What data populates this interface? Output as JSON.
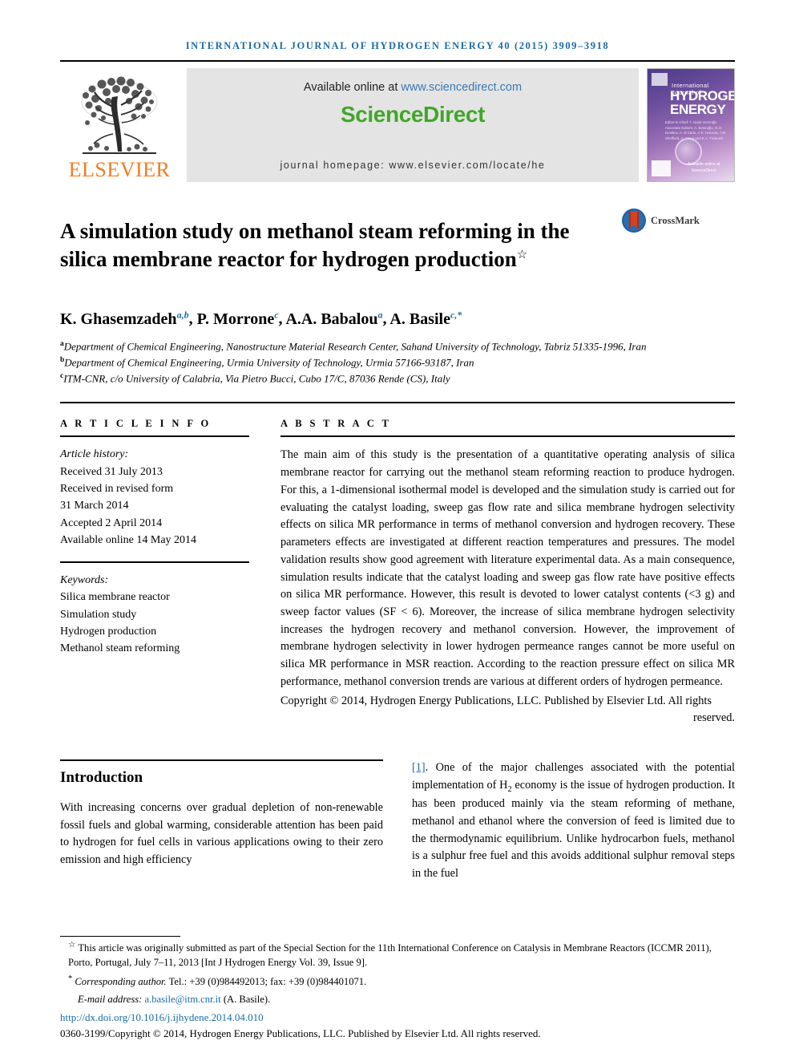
{
  "running_head": "International Journal of Hydrogen Energy 40 (2015) 3909–3918",
  "masthead": {
    "publisher": "ELSEVIER",
    "available_prefix": "Available online at ",
    "available_url": "www.sciencedirect.com",
    "sciencedirect_logo": "ScienceDirect",
    "journal_homepage": "journal homepage: www.elsevier.com/locate/he",
    "cover": {
      "line1": "International Journal of",
      "line2": "HYDROGEN",
      "line3": "ENERGY",
      "editors": "Editor-in-Chief: T. Nejat Veziroğlu    Associate Editors: A. Bekiroğlu, D.O. Dunikov, A. di Carlo, A.E. Hosoda, J.W. Sheffield, G. Gürel and E.A. Ticianelli",
      "footer": "Available online at ScienceDirect"
    }
  },
  "article": {
    "title": "A simulation study on methanol steam reforming in the silica membrane reactor for hydrogen production",
    "title_footnote_marker": "☆",
    "crossmark_label": "CrossMark",
    "authors": [
      {
        "name": "K. Ghasemzadeh",
        "marks": "a,b"
      },
      {
        "name": "P. Morrone",
        "marks": "c"
      },
      {
        "name": "A.A. Babalou",
        "marks": "a"
      },
      {
        "name": "A. Basile",
        "marks": "c,*"
      }
    ],
    "affiliations": [
      {
        "mark": "a",
        "text": "Department of Chemical Engineering, Nanostructure Material Research Center, Sahand University of Technology, Tabriz 51335-1996, Iran"
      },
      {
        "mark": "b",
        "text": "Department of Chemical Engineering, Urmia University of Technology, Urmia 57166-93187, Iran"
      },
      {
        "mark": "c",
        "text": "ITM-CNR, c/o University of Calabria, Via Pietro Bucci, Cubo 17/C, 87036 Rende (CS), Italy"
      }
    ]
  },
  "article_info": {
    "heading": "A R T I C L E   I N F O",
    "history_label": "Article history:",
    "history": [
      "Received 31 July 2013",
      "Received in revised form",
      "31 March 2014",
      "Accepted 2 April 2014",
      "Available online 14 May 2014"
    ],
    "keywords_label": "Keywords:",
    "keywords": [
      "Silica membrane reactor",
      "Simulation study",
      "Hydrogen production",
      "Methanol steam reforming"
    ]
  },
  "abstract": {
    "heading": "A B S T R A C T",
    "text": "The main aim of this study is the presentation of a quantitative operating analysis of silica membrane reactor for carrying out the methanol steam reforming reaction to produce hydrogen. For this, a 1-dimensional isothermal model is developed and the simulation study is carried out for evaluating the catalyst loading, sweep gas flow rate and silica membrane hydrogen selectivity effects on silica MR performance in terms of methanol conversion and hydrogen recovery. These parameters effects are investigated at different reaction temperatures and pressures. The model validation results show good agreement with literature experimental data. As a main consequence, simulation results indicate that the catalyst loading and sweep gas flow rate have positive effects on silica MR performance. However, this result is devoted to lower catalyst contents (<3 g) and sweep factor values (SF < 6). Moreover, the increase of silica membrane hydrogen selectivity increases the hydrogen recovery and methanol conversion. However, the improvement of membrane hydrogen selectivity in lower hydrogen permeance ranges cannot be more useful on silica MR performance in MSR reaction. According to the reaction pressure effect on silica MR performance, methanol conversion trends are various at different orders of hydrogen permeance.",
    "copyright": "Copyright © 2014, Hydrogen Energy Publications, LLC. Published by Elsevier Ltd. All rights",
    "copyright_tail": "reserved."
  },
  "body": {
    "section_title": "Introduction",
    "left_paragraph": "With increasing concerns over gradual depletion of non-renewable fossil fuels and global warming, considerable attention has been paid to hydrogen for fuel cells in various applications owing to their zero emission and high efficiency",
    "right_reference": "[1]",
    "right_paragraph": ". One of the major challenges associated with the potential implementation of H2 economy is the issue of hydrogen production. It has been produced mainly via the steam reforming of methane, methanol and ethanol where the conversion of feed is limited due to the thermodynamic equilibrium. Unlike hydrocarbon fuels, methanol is a sulphur free fuel and this avoids additional sulphur removal steps in the fuel"
  },
  "footnotes": {
    "star_marker": "☆",
    "star_text": "This article was originally submitted as part of the Special Section for the 11th International Conference on Catalysis in Membrane Reactors (ICCMR 2011), Porto, Portugal, July 7–11, 2013 [Int J Hydrogen Energy Vol. 39, Issue 9].",
    "corresponding_marker": "*",
    "corresponding_label": "Corresponding author.",
    "corresponding_text": " Tel.: +39 (0)984492013; fax: +39 (0)984401071.",
    "email_label": "E-mail address: ",
    "email": "a.basile@itm.cnr.it",
    "email_suffix": " (A. Basile).",
    "doi": "http://dx.doi.org/10.1016/j.ijhydene.2014.04.010",
    "issn_line": "0360-3199/Copyright © 2014, Hydrogen Energy Publications, LLC. Published by Elsevier Ltd. All rights reserved."
  },
  "colors": {
    "journal_blue": "#1b6ca8",
    "elsevier_orange": "#F47B20",
    "sciencedirect_green": "#41A62A",
    "banner_gray": "#e4e4e4"
  }
}
